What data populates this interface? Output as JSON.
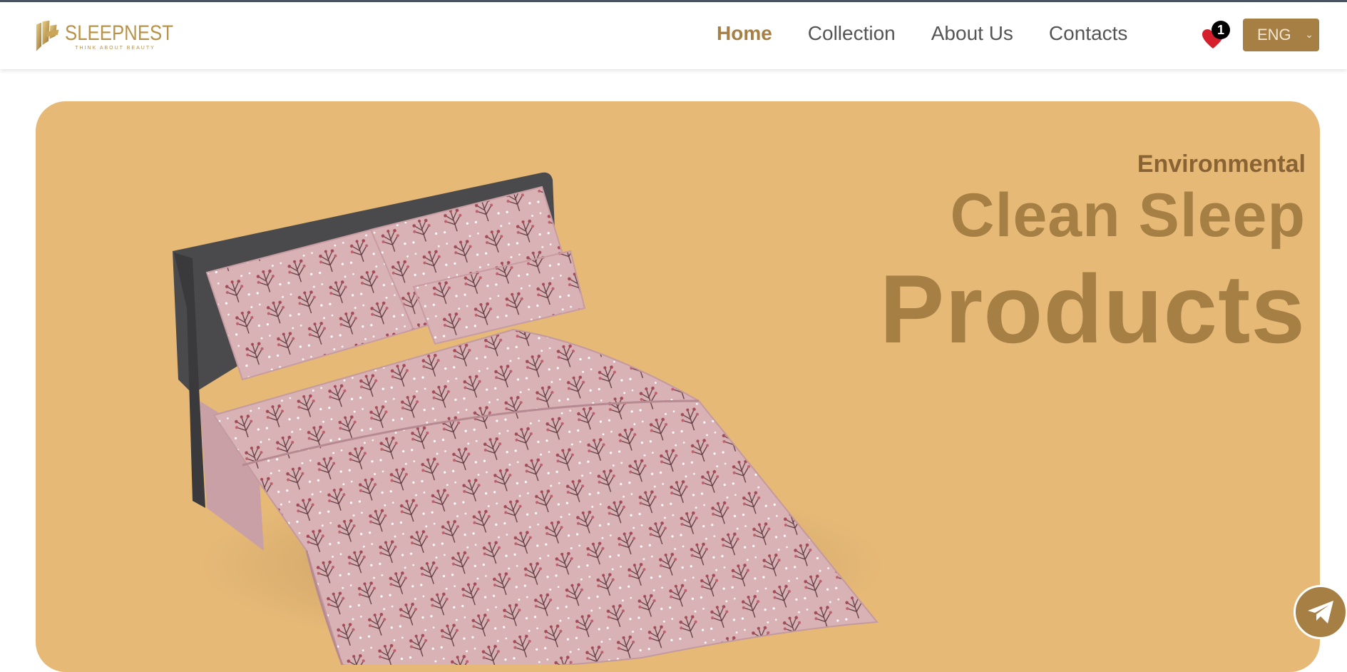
{
  "brand": {
    "name": "SLEEPNEST",
    "tagline": "THINK ABOUT BEAUTY"
  },
  "nav": {
    "items": [
      {
        "label": "Home",
        "active": true
      },
      {
        "label": "Collection",
        "active": false
      },
      {
        "label": "About Us",
        "active": false
      },
      {
        "label": "Contacts",
        "active": false
      }
    ]
  },
  "favorites": {
    "count": "1",
    "icon": "heart-icon"
  },
  "language": {
    "selected": "ENG"
  },
  "hero": {
    "eyebrow": "Environmental",
    "title_line1": "Clean Sleep",
    "title_line2": "Products",
    "image": "bed-with-floral-bedding"
  },
  "floating": {
    "icon": "telegram-icon"
  },
  "colors": {
    "accent": "#a67f45",
    "hero_bg": "#e6b977",
    "nav_text": "#555555",
    "badge_heart": "#d61f2c"
  }
}
